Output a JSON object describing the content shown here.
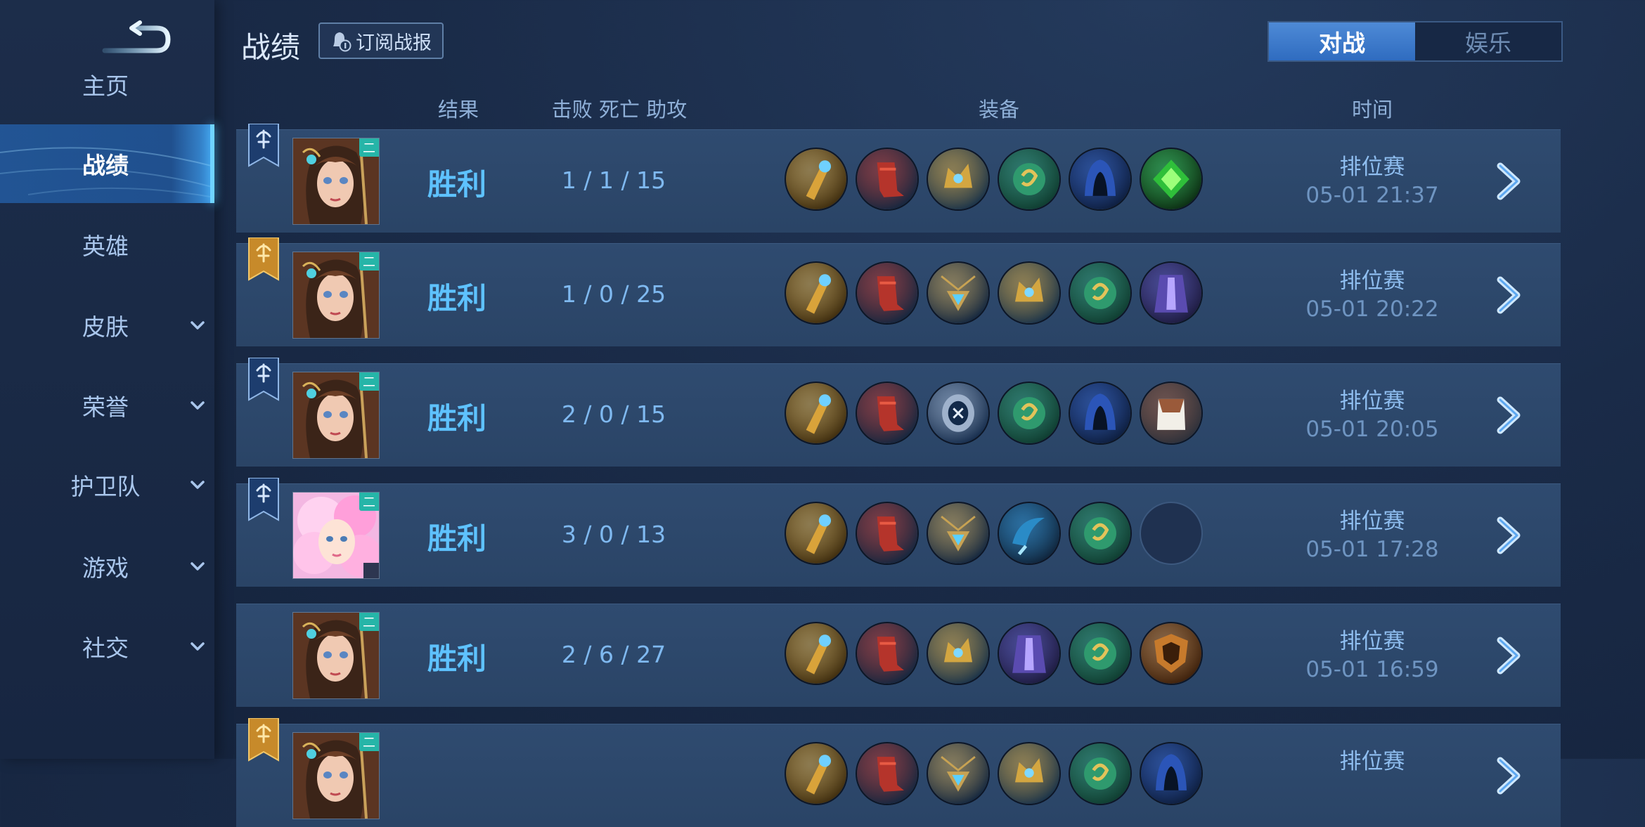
{
  "sidebar": {
    "items": [
      {
        "label": "主页",
        "active": false,
        "expandable": false
      },
      {
        "label": "战绩",
        "active": true,
        "expandable": false
      },
      {
        "label": "英雄",
        "active": false,
        "expandable": false
      },
      {
        "label": "皮肤",
        "active": false,
        "expandable": true
      },
      {
        "label": "荣誉",
        "active": false,
        "expandable": true
      },
      {
        "label": "护卫队",
        "active": false,
        "expandable": true
      },
      {
        "label": "游戏",
        "active": false,
        "expandable": true
      },
      {
        "label": "社交",
        "active": false,
        "expandable": true
      }
    ]
  },
  "header": {
    "title": "战绩",
    "subscribe_label": "订阅战报",
    "mode_tabs": [
      {
        "label": "对战",
        "active": true
      },
      {
        "label": "娱乐",
        "active": false
      }
    ]
  },
  "columns": {
    "result": "结果",
    "kda": "击败  死亡  助攻",
    "equipment": "装备",
    "time": "时间"
  },
  "colors": {
    "accent": "#5ec2ff",
    "row_bg": "#2f4b70",
    "active_tab": "#3a78cc",
    "badge": "#26b5a8"
  },
  "matches": [
    {
      "flag": "blue",
      "hero": "hero-a",
      "badge": "二",
      "result": "胜利",
      "kda": "1 / 1 / 15",
      "mode": "排位赛",
      "time": "05-01  21:37",
      "items": [
        "gold-staff",
        "red-boots",
        "gold-crown",
        "green-amulet",
        "blue-hood",
        "green-gem"
      ]
    },
    {
      "flag": "gold",
      "hero": "hero-a",
      "badge": "二",
      "result": "胜利",
      "kda": "1 / 0 / 25",
      "mode": "排位赛",
      "time": "05-01  20:22",
      "items": [
        "gold-staff",
        "red-boots",
        "pendant",
        "gold-crown",
        "green-amulet",
        "purple-cloak"
      ]
    },
    {
      "flag": "blue",
      "hero": "hero-a",
      "badge": "二",
      "result": "胜利",
      "kda": "2 / 0 / 15",
      "mode": "排位赛",
      "time": "05-01  20:05",
      "items": [
        "gold-staff",
        "red-boots",
        "silver-mask",
        "green-amulet",
        "blue-hood",
        "leather-armor"
      ]
    },
    {
      "flag": "blue",
      "hero": "hero-b",
      "badge": "二",
      "result": "胜利",
      "kda": "3 / 0 / 13",
      "mode": "排位赛",
      "time": "05-01  17:28",
      "items": [
        "gold-staff",
        "red-boots",
        "pendant",
        "blue-scythe",
        "green-amulet",
        "empty"
      ]
    },
    {
      "flag": "none",
      "hero": "hero-a",
      "badge": "二",
      "result": "胜利",
      "kda": "2 / 6 / 27",
      "mode": "排位赛",
      "time": "05-01  16:59",
      "items": [
        "gold-staff",
        "red-boots",
        "gold-crown",
        "purple-cloak",
        "green-amulet",
        "bronze-shield"
      ]
    },
    {
      "flag": "gold",
      "hero": "hero-a",
      "badge": "二",
      "result": "",
      "kda": "",
      "mode": "排位赛",
      "time": "",
      "items": [
        "gold-staff",
        "red-boots",
        "pendant",
        "gold-crown",
        "green-amulet",
        "blue-hood"
      ]
    }
  ]
}
